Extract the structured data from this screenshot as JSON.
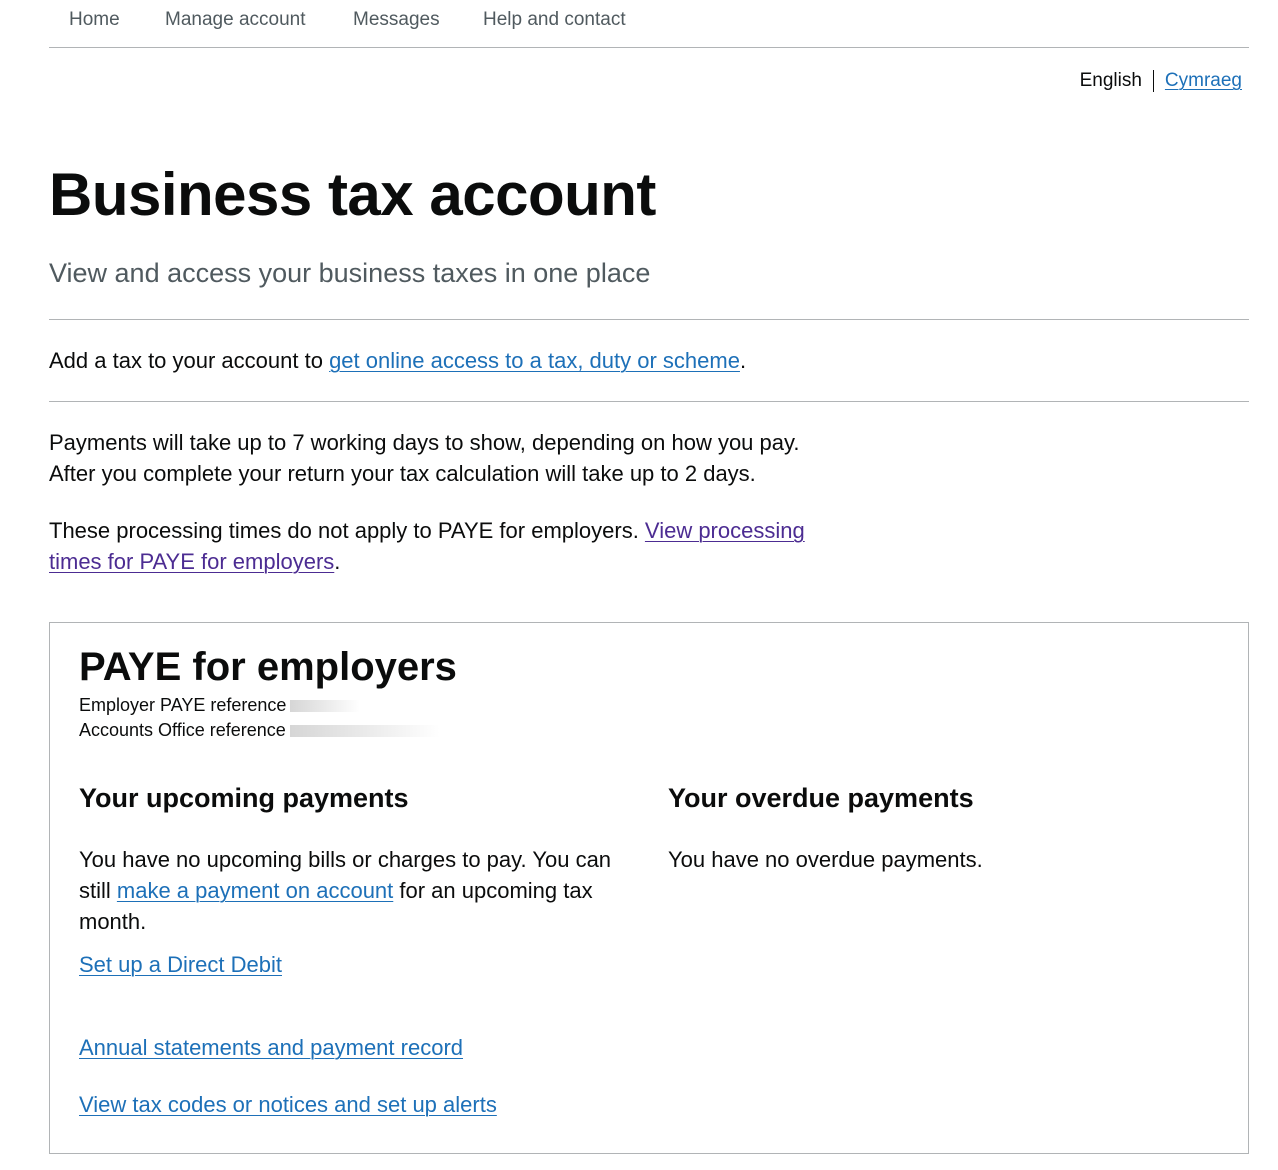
{
  "nav": {
    "items": [
      "Home",
      "Manage account",
      "Messages",
      "Help and contact"
    ]
  },
  "language": {
    "current": "English",
    "alternate": "Cymraeg"
  },
  "page": {
    "title": "Business tax account",
    "subtitle": "View and access your business taxes in one place"
  },
  "add_tax": {
    "prefix": "Add a tax to your account to ",
    "link": "get online access to a tax, duty or scheme",
    "suffix": "."
  },
  "processing": {
    "line1": "Payments will take up to 7 working days to show, depending on how you pay.",
    "line2": "After you complete your return your tax calculation will take up to 2 days.",
    "paye_prefix": "These processing times do not apply to PAYE for employers. ",
    "paye_link": "View processing times for PAYE for employers",
    "paye_suffix": "."
  },
  "paye": {
    "title": "PAYE for employers",
    "employer_ref_label": "Employer PAYE reference",
    "accounts_ref_label": "Accounts Office reference",
    "upcoming": {
      "heading": "Your upcoming payments",
      "text_prefix": "You have no upcoming bills or charges to pay. You can still ",
      "link": "make a payment on account",
      "text_suffix": " for an upcoming tax month.",
      "direct_debit": "Set up a Direct Debit"
    },
    "overdue": {
      "heading": "Your overdue payments",
      "text": "You have no overdue payments."
    },
    "links": {
      "annual": "Annual statements and payment record",
      "tax_codes": "View tax codes or notices and set up alerts"
    }
  }
}
